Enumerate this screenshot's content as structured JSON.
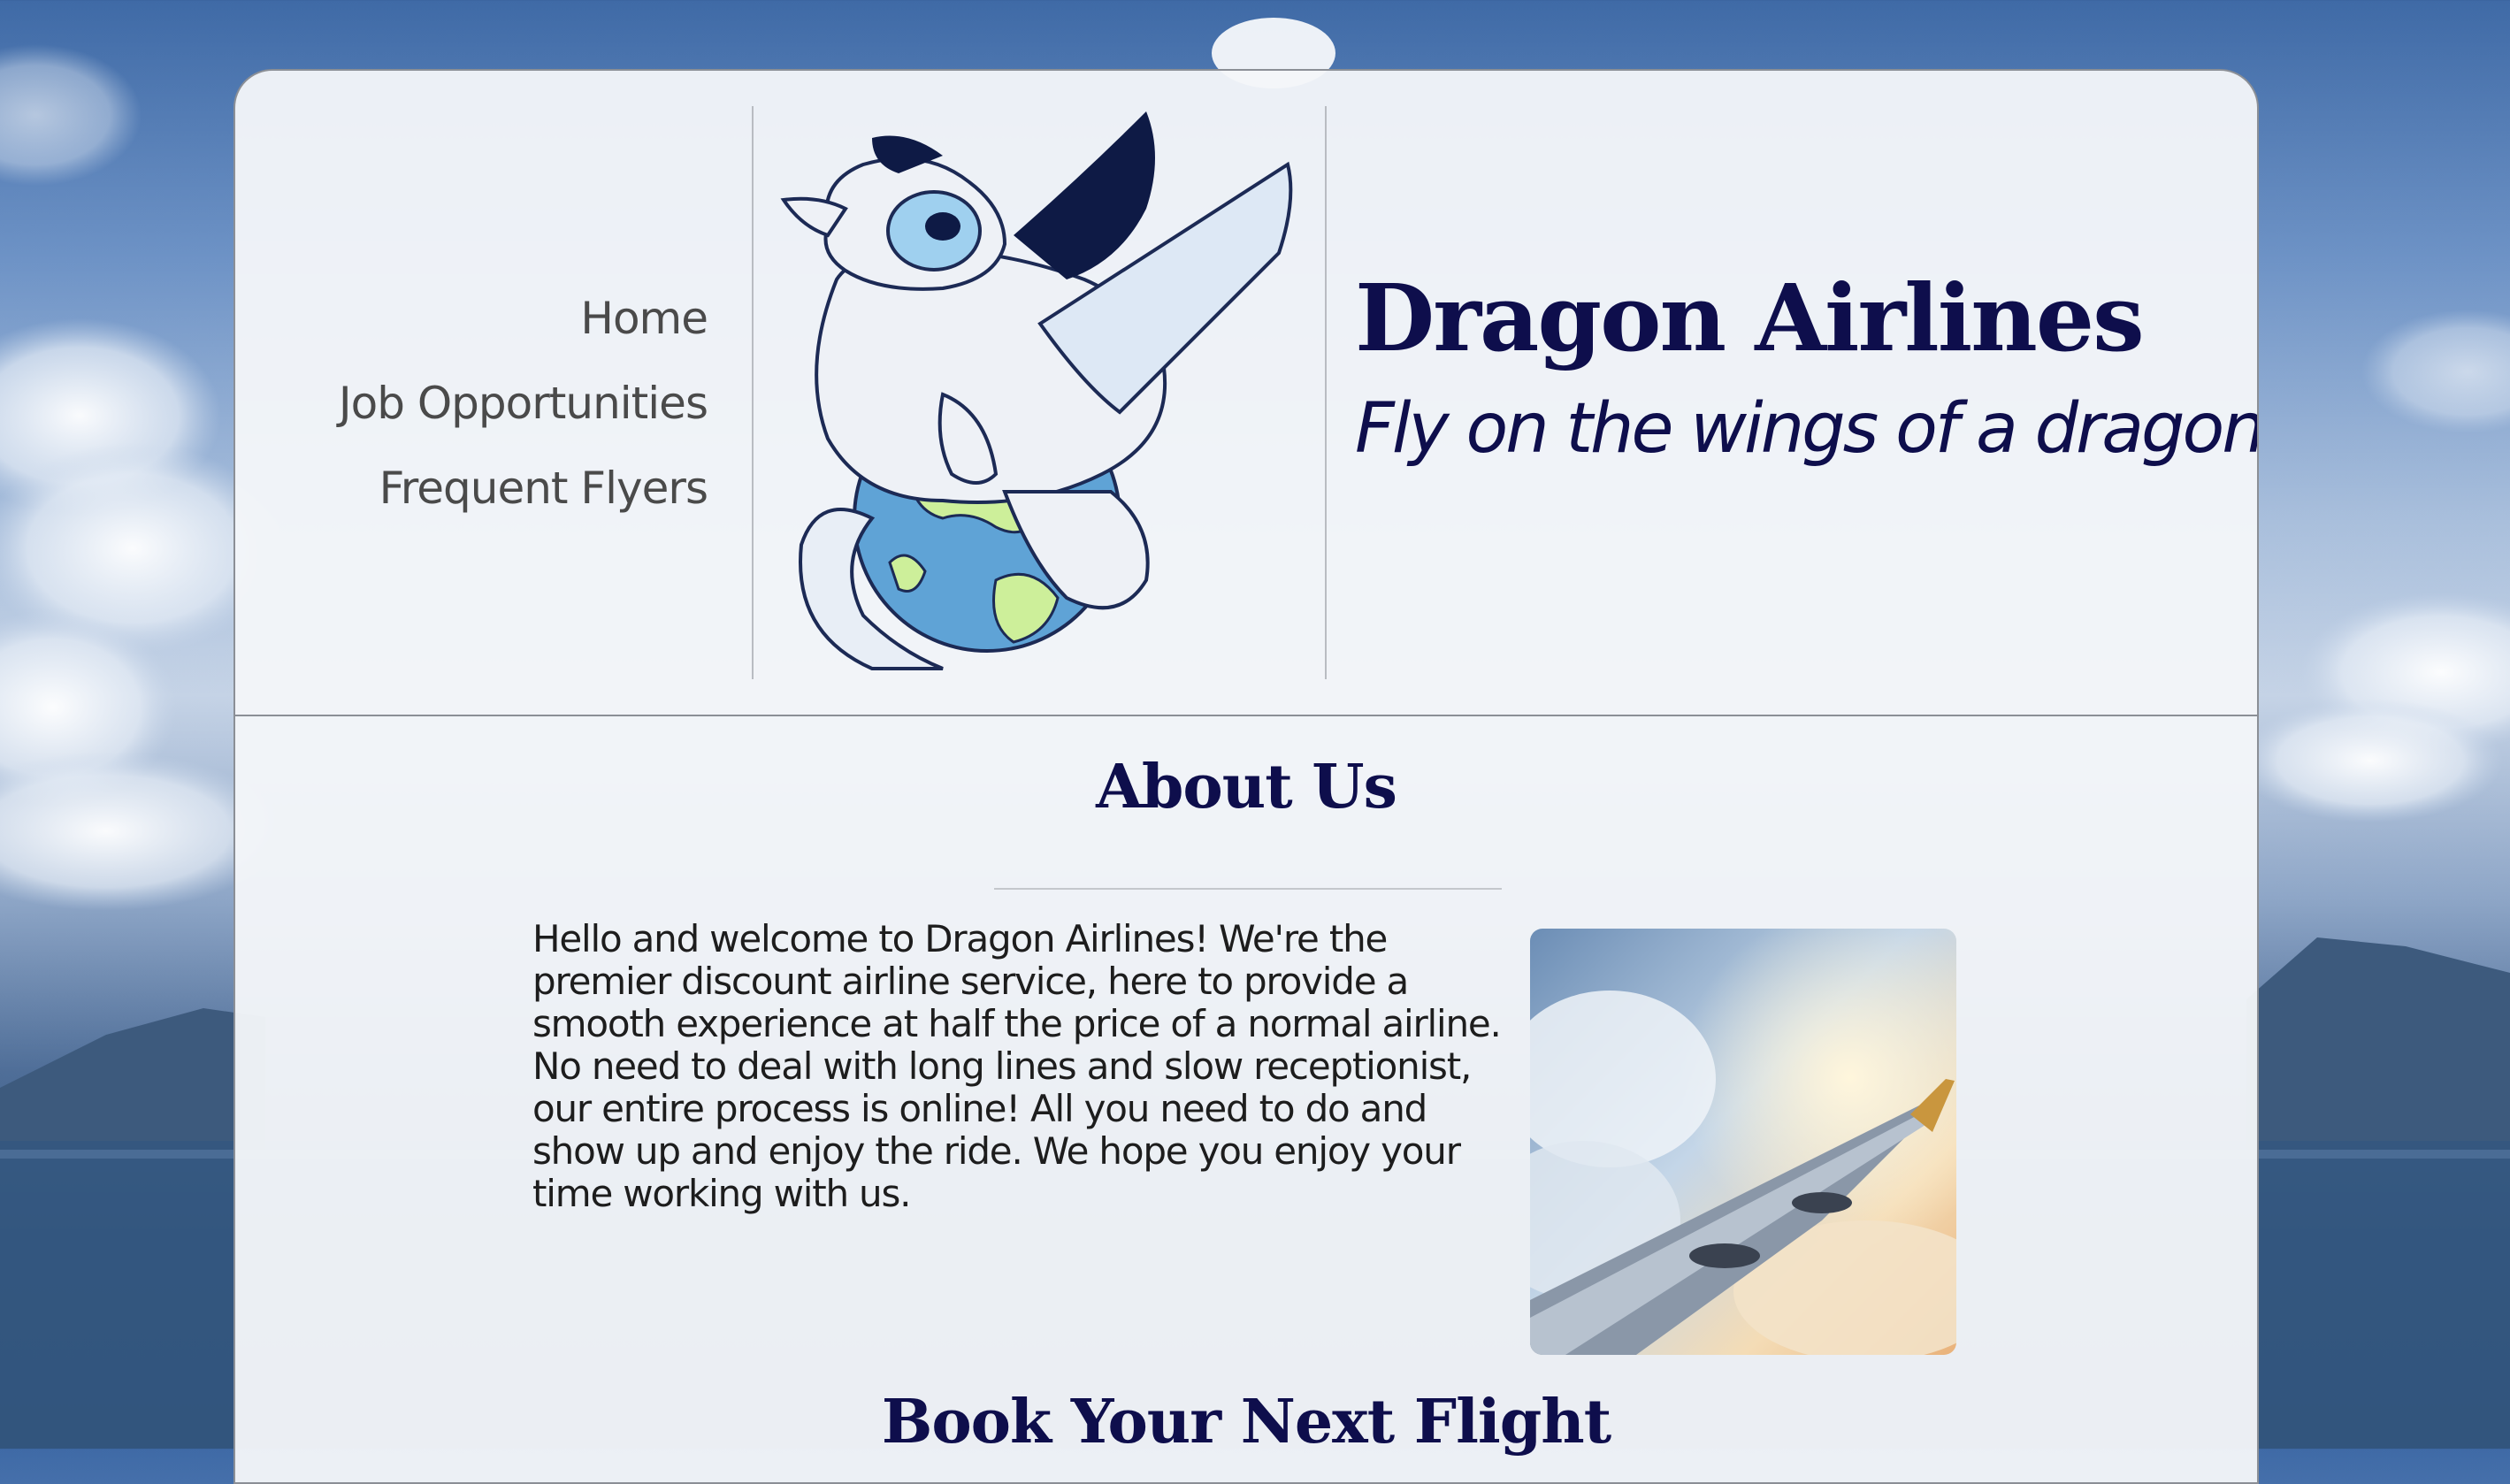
{
  "nav": {
    "items": [
      {
        "label": "Home"
      },
      {
        "label": "Job Opportunities"
      },
      {
        "label": "Frequent Flyers"
      }
    ]
  },
  "brand": {
    "title": "Dragon Airlines",
    "tagline": "Fly on the wings of a dragon"
  },
  "about": {
    "heading": "About Us",
    "body": "Hello and welcome to Dragon Airlines! We're the premier discount airline service, here to provide a smooth experience at half the price of a normal airline. No need to deal with long lines and slow receptionist, our entire process is online! All you need to do and show up and enjoy the ride. We hope you enjoy your time working with us."
  },
  "booking": {
    "heading": "Book Your Next Flight"
  },
  "colors": {
    "heading": "#0e0e4c",
    "nav_text": "#4a4a4a",
    "card_bg": "#f4f6f9",
    "border": "#8b8f96"
  },
  "icons": {
    "logo": "dragon-on-globe-logo",
    "photo": "airplane-wing-clouds-photo"
  }
}
